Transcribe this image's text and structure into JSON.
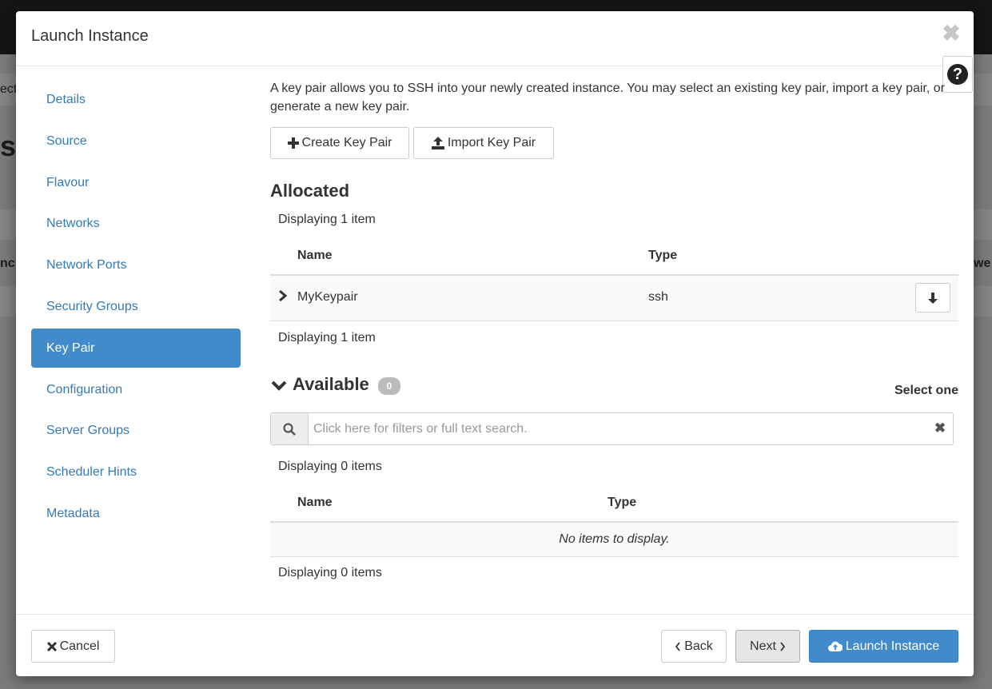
{
  "background": {
    "fragment_left_1": "ect",
    "fragment_left_2": "st",
    "fragment_left_3": "nc",
    "fragment_right": "we"
  },
  "modal": {
    "title": "Launch Instance",
    "close_glyph": "✖",
    "help_glyph": "?"
  },
  "nav": {
    "items": [
      {
        "label": "Details"
      },
      {
        "label": "Source"
      },
      {
        "label": "Flavour"
      },
      {
        "label": "Networks"
      },
      {
        "label": "Network Ports"
      },
      {
        "label": "Security Groups"
      },
      {
        "label": "Key Pair"
      },
      {
        "label": "Configuration"
      },
      {
        "label": "Server Groups"
      },
      {
        "label": "Scheduler Hints"
      },
      {
        "label": "Metadata"
      }
    ],
    "active": "Key Pair"
  },
  "keypair": {
    "intro": "A key pair allows you to SSH into your newly created instance. You may select an existing key pair, import a key pair, or generate a new key pair.",
    "create_label": "Create Key Pair",
    "import_label": "Import Key Pair",
    "allocated": {
      "title": "Allocated",
      "count_top": "Displaying 1 item",
      "col_name": "Name",
      "col_type": "Type",
      "rows": [
        {
          "name": "MyKeypair",
          "type": "ssh"
        }
      ],
      "count_bottom": "Displaying 1 item"
    },
    "available": {
      "title": "Available",
      "badge": "0",
      "select_hint": "Select one",
      "search_placeholder": "Click here for filters or full text search.",
      "count_top": "Displaying 0 items",
      "col_name": "Name",
      "col_type": "Type",
      "empty": "No items to display.",
      "count_bottom": "Displaying 0 items"
    }
  },
  "footer": {
    "cancel": "Cancel",
    "back": "Back",
    "next": "Next",
    "launch": "Launch Instance"
  },
  "colors": {
    "primary": "#428bca",
    "link": "#337ab7"
  },
  "icons": [
    "close-icon",
    "help-icon",
    "plus-icon",
    "upload-icon",
    "chevron-right-icon",
    "arrow-down-icon",
    "chevron-down-icon",
    "search-icon",
    "clear-icon",
    "times-icon",
    "chevron-left-icon",
    "cloud-upload-icon"
  ]
}
